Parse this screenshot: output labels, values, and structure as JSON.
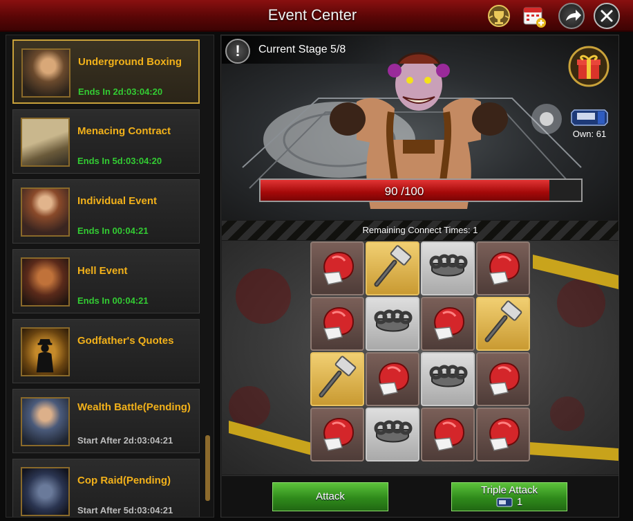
{
  "header": {
    "title": "Event Center",
    "icons": [
      "trophy-icon",
      "calendar-add-icon",
      "share-arrow-icon",
      "close-icon"
    ]
  },
  "sidebar": {
    "events": [
      {
        "name": "Underground Boxing",
        "time": "Ends In 2d:03:04:20",
        "selected": true
      },
      {
        "name": "Menacing Contract",
        "time": "Ends In 5d:03:04:20"
      },
      {
        "name": "Individual Event",
        "time": "Ends In 00:04:21"
      },
      {
        "name": "Hell Event",
        "time": "Ends In 00:04:21"
      },
      {
        "name": "Godfather's Quotes",
        "time": ""
      },
      {
        "name": "Wealth Battle(Pending)",
        "time": "Start After 2d:03:04:21"
      },
      {
        "name": "Cop Raid(Pending)",
        "time": "Start After 5d:03:04:21"
      }
    ]
  },
  "stage": {
    "label": "Current Stage 5/8",
    "own_label": "Own: 61",
    "boss_hp_text": "90 /100",
    "boss_hp_value": 90,
    "boss_hp_max": 100
  },
  "board": {
    "remaining_text": "Remaining Connect Times: 1",
    "tiles": [
      [
        "glove",
        "hammer",
        "knuckles",
        "glove"
      ],
      [
        "glove",
        "knuckles",
        "glove",
        "hammer"
      ],
      [
        "hammer",
        "glove",
        "knuckles",
        "glove"
      ],
      [
        "glove",
        "knuckles",
        "glove",
        "glove"
      ]
    ]
  },
  "actions": {
    "attack_label": "Attack",
    "triple_attack_label": "Triple Attack",
    "triple_attack_cost": "1"
  }
}
